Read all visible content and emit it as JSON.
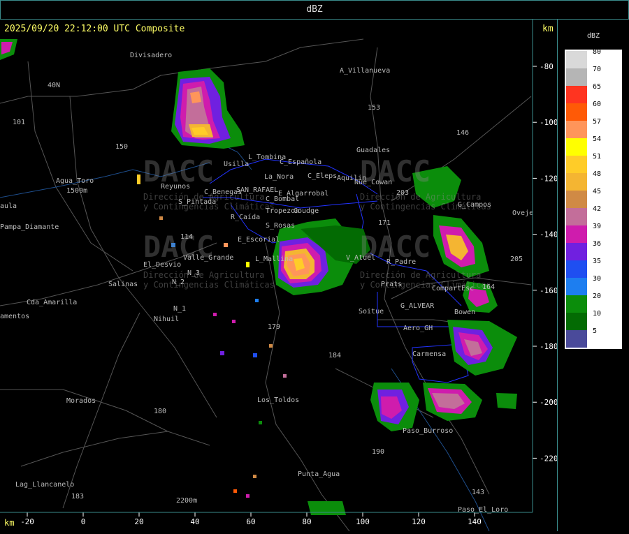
{
  "header": {
    "title": "dBZ"
  },
  "map": {
    "title": "2025/09/20 22:12:00 UTC Composite",
    "axis_unit_top": "km",
    "axis_unit_bottom": "km",
    "y_ticks": [
      -80,
      -100,
      -120,
      -140,
      -160,
      -180,
      -200,
      -220
    ],
    "x_ticks": [
      -20,
      0,
      20,
      40,
      60,
      80,
      100,
      120,
      140
    ],
    "watermark": [
      "DACC",
      "Dirección de Agricultura",
      "y Contingencias Climáticas"
    ],
    "places": [
      "Divisadero",
      "A_Villanueva",
      "40N",
      "101",
      "Agua_Toro",
      "1500m",
      "aula",
      "Pampa_Diamante",
      "Reyunos",
      "S_Pintada",
      "Usilla",
      "L_Tombina",
      "C_Española",
      "La_Nora",
      "C_Eleps",
      "C_Benegas",
      "SAN_RAFAEL",
      "E_Algarrobal",
      "C_Bombal",
      "R_Caída",
      "Tropezon",
      "Goudge",
      "S_Rosas",
      "E_Escorial",
      "Valle_Grande",
      "L_Mallina",
      "El_Desvio",
      "Salinas",
      "N_2",
      "N_3",
      "N_1",
      "Nihuil",
      "Cda_Amarilla",
      "amentos",
      "Guadales",
      "Aquilin",
      "Nue_Cowan",
      "G_Campos",
      "Oveje",
      "V_Atuel",
      "R_Padre",
      "Prats",
      "CompartEsc",
      "G_ALVEAR",
      "Bowen",
      "Soitue",
      "Aero_GH",
      "Carmensa",
      "Morados",
      "Los_Toldos",
      "Paso_Burroso",
      "Punta_Agua",
      "Lag_Llancanelo",
      "2200m",
      "Paso_El_Loro",
      "153",
      "146",
      "171",
      "203",
      "205",
      "179",
      "184",
      "180",
      "183",
      "190",
      "143",
      "150",
      "114",
      "164"
    ],
    "colors": {
      "frame": "#3a8c8c",
      "roads": "#666666",
      "rivers": "#1e4e8c",
      "boundaries": "#2233ff",
      "label": "#bbbbbb",
      "title": "#ffff66"
    }
  },
  "legend": {
    "unit": "dBZ",
    "items": [
      {
        "value": "80",
        "color": "#d9d9d9"
      },
      {
        "value": "70",
        "color": "#b5b5b5"
      },
      {
        "value": "65",
        "color": "#ff3420"
      },
      {
        "value": "60",
        "color": "#ff5a06"
      },
      {
        "value": "57",
        "color": "#ff955a"
      },
      {
        "value": "54",
        "color": "#ffff00"
      },
      {
        "value": "51",
        "color": "#ffcc28"
      },
      {
        "value": "48",
        "color": "#f4b532"
      },
      {
        "value": "45",
        "color": "#d08a45"
      },
      {
        "value": "42",
        "color": "#c36e9a"
      },
      {
        "value": "39",
        "color": "#cf1cad"
      },
      {
        "value": "36",
        "color": "#7020e0"
      },
      {
        "value": "35",
        "color": "#1f4ff1"
      },
      {
        "value": "30",
        "color": "#1d7ef0"
      },
      {
        "value": "20",
        "color": "#0b8d0b"
      },
      {
        "value": "10",
        "color": "#036b03"
      },
      {
        "value": "5",
        "color": "#4a4a9a"
      }
    ]
  }
}
